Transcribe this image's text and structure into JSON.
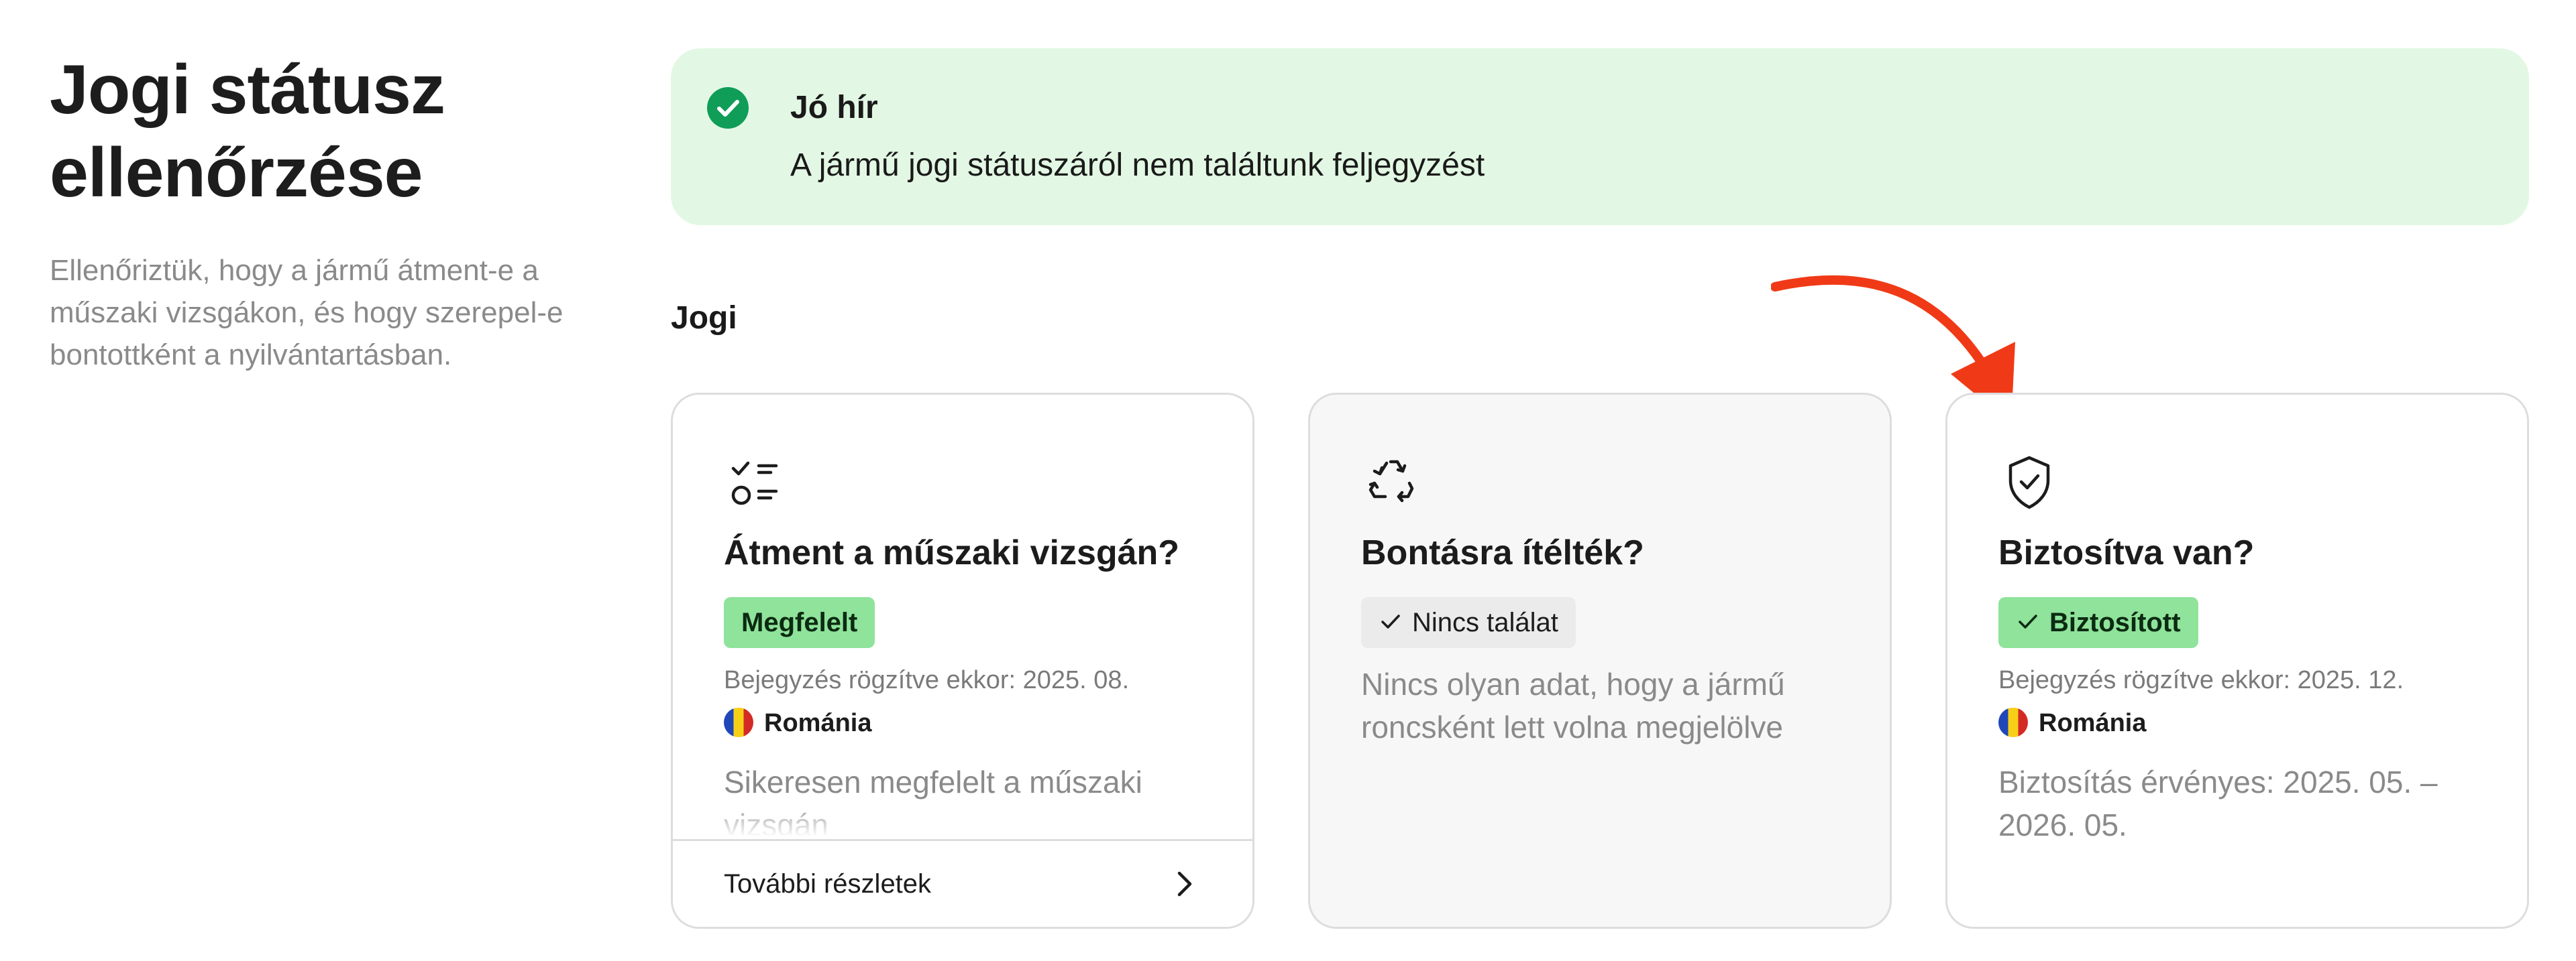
{
  "page": {
    "title": "Jogi státusz ellenőrzése",
    "description": "Ellenőriztük, hogy a jármű átment-e a műszaki vizsgákon, és hogy szerepel-e bontottként a nyilvántartásban."
  },
  "banner": {
    "title": "Jó hír",
    "text": "A jármű jogi státuszáról nem találtunk feljegyzést",
    "icon": "check-circle-icon",
    "color": "#e3f8e4",
    "accent": "#0f9d58"
  },
  "section": {
    "title": "Jogi"
  },
  "annotation": {
    "color": "#f03a17",
    "icon": "arrow-annotation"
  },
  "cards": {
    "inspection": {
      "icon": "checklist-icon",
      "title": "Átment a műszaki vizsgán?",
      "badge": "Megfelelt",
      "record": "Bejegyzés rögzítve ekkor: 2025. 08.",
      "country": "Románia",
      "flag": "romania-flag-icon",
      "text": "Sikeresen megfelelt a műszaki vizsgán",
      "link": "További részletek",
      "link_icon": "chevron-right-icon"
    },
    "scrapped": {
      "icon": "recycle-icon",
      "title": "Bontásra ítélték?",
      "badge": "Nincs találat",
      "text": "Nincs olyan adat, hogy a jármű roncsként lett volna megjelölve"
    },
    "insurance": {
      "icon": "shield-check-icon",
      "title": "Biztosítva van?",
      "badge": "Biztosított",
      "record": "Bejegyzés rögzítve ekkor: 2025. 12.",
      "country": "Románia",
      "flag": "romania-flag-icon",
      "text": "Biztosítás érvényes: 2025. 05. – 2026. 05."
    }
  },
  "colors": {
    "badge_green": "#8fe39b",
    "badge_gray": "#ebebeb",
    "card_border": "#dddddd",
    "muted_text": "#8a8a8a"
  }
}
